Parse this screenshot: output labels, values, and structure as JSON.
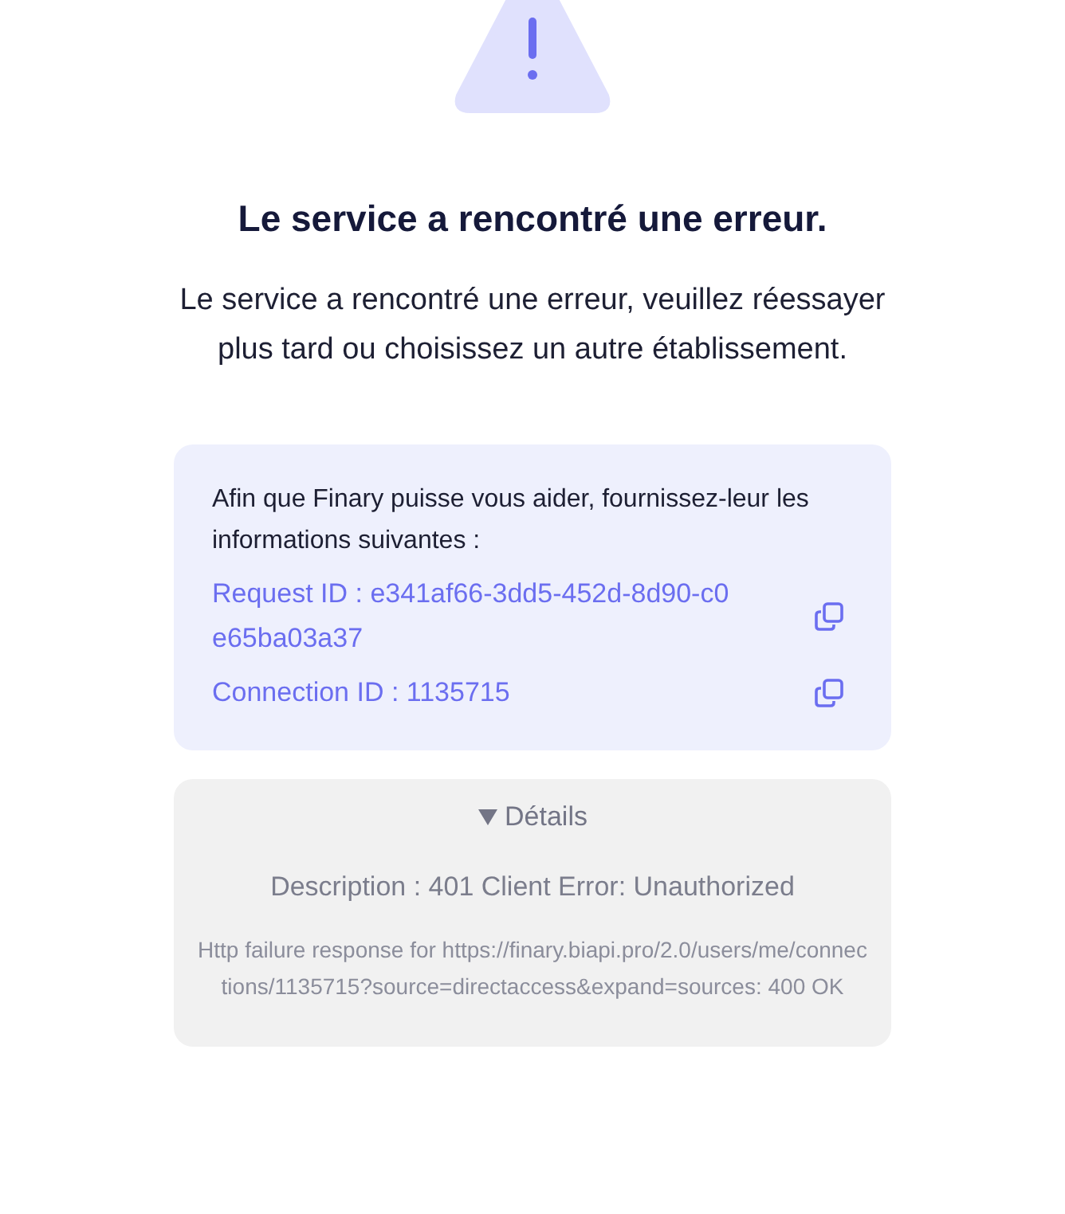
{
  "title": "Le service a rencontré une erreur.",
  "message": "Le service a rencontré une erreur, veuillez réessayer plus tard ou choisissez un autre établissement.",
  "info": {
    "intro": "Afin que Finary puisse vous aider, fournissez-leur les informations suivantes :",
    "ids": [
      {
        "text": "Request ID : e341af66-3dd5-452d-8d90-c0e65ba03a37"
      },
      {
        "text": "Connection ID : 1135715"
      }
    ]
  },
  "details": {
    "label": "Détails",
    "expanded": true,
    "description": "Description : 401 Client Error: Unauthorized",
    "message": "Http failure response for https://finary.biapi.pro/2.0/users/me/connections/1135715?source=directaccess&expand=sources: 400 OK"
  }
}
